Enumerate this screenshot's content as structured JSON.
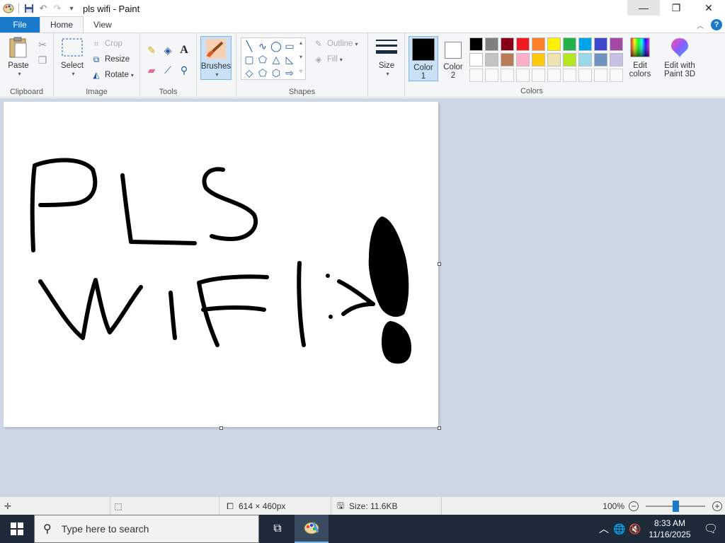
{
  "window": {
    "title": "pls wifi - Paint",
    "min_icon": "minimize-icon",
    "max_icon": "restore-icon",
    "close_icon": "close-icon"
  },
  "tabs": [
    {
      "label": "File"
    },
    {
      "label": "Home"
    },
    {
      "label": "View"
    }
  ],
  "ribbon": {
    "clipboard": {
      "group_label": "Clipboard",
      "paste": "Paste"
    },
    "image": {
      "group_label": "Image",
      "select": "Select",
      "crop": "Crop",
      "resize": "Resize",
      "rotate": "Rotate"
    },
    "tools": {
      "group_label": "Tools"
    },
    "brushes": {
      "label": "Brushes"
    },
    "shapes": {
      "group_label": "Shapes",
      "outline": "Outline",
      "fill": "Fill"
    },
    "size": {
      "label": "Size"
    },
    "color1": {
      "label": "Color",
      "num": "1",
      "color": "#000000"
    },
    "color2": {
      "label": "Color",
      "num": "2",
      "color": "#ffffff"
    },
    "colors": {
      "group_label": "Colors",
      "row1": [
        "#000000",
        "#7f7f7f",
        "#880015",
        "#ed1c24",
        "#ff7f27",
        "#fff200",
        "#22b14c",
        "#00a2e8",
        "#3f48cc",
        "#a349a4"
      ],
      "row2": [
        "#ffffff",
        "#c3c3c3",
        "#b97a57",
        "#ffaec9",
        "#ffc90e",
        "#efe4b0",
        "#b5e61d",
        "#99d9ea",
        "#7092be",
        "#c8bfe7"
      ]
    },
    "edit_colors": {
      "line1": "Edit",
      "line2": "colors"
    },
    "paint3d": {
      "line1": "Edit with",
      "line2": "Paint 3D"
    }
  },
  "statusbar": {
    "dimensions": "614 × 460px",
    "size": "Size: 11.6KB",
    "zoom": "100%",
    "zoom_level": 0.5
  },
  "taskbar": {
    "search_placeholder": "Type here to search",
    "time": "8:33 AM",
    "date": "11/16/2025"
  }
}
